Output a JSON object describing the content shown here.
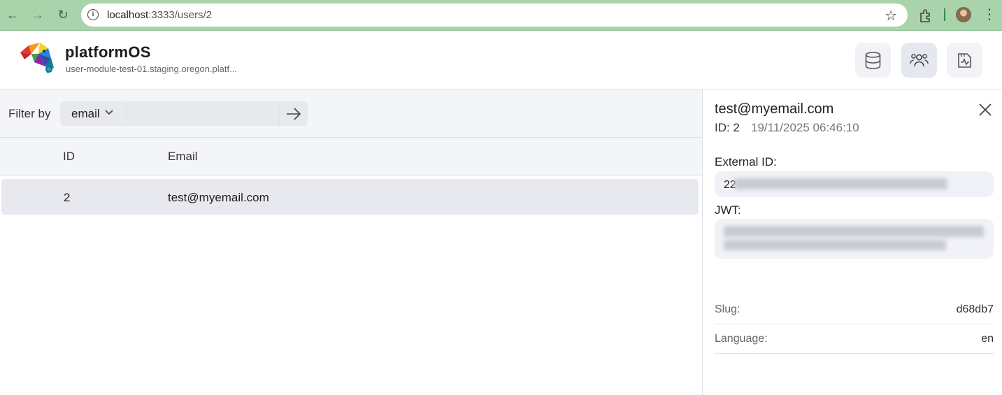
{
  "browser": {
    "url_host": "localhost",
    "url_path": ":3333/users/2"
  },
  "header": {
    "brand": "platformOS",
    "instance": "user-module-test-01.staging.oregon.platf...",
    "buttons": [
      {
        "icon": "database-icon"
      },
      {
        "icon": "users-icon",
        "active": true
      },
      {
        "icon": "logs-icon"
      }
    ]
  },
  "filter": {
    "label": "Filter by",
    "field": "email",
    "value": ""
  },
  "table": {
    "columns": [
      "ID",
      "Email"
    ],
    "rows": [
      {
        "id": "2",
        "email": "test@myemail.com"
      }
    ]
  },
  "detail": {
    "email": "test@myemail.com",
    "id_text": "ID: 2",
    "created": "19/11/2025 06:46:10",
    "external_id_label": "External ID:",
    "external_id_visible": "22",
    "jwt_label": "JWT:",
    "slug_label": "Slug:",
    "slug_value": "d68db7",
    "language_label": "Language:",
    "language_value": "en"
  },
  "colors": {
    "chrome": "#a9d3ab",
    "panel_bg": "#f4f5f9",
    "selected_row": "#e8e9ef"
  }
}
